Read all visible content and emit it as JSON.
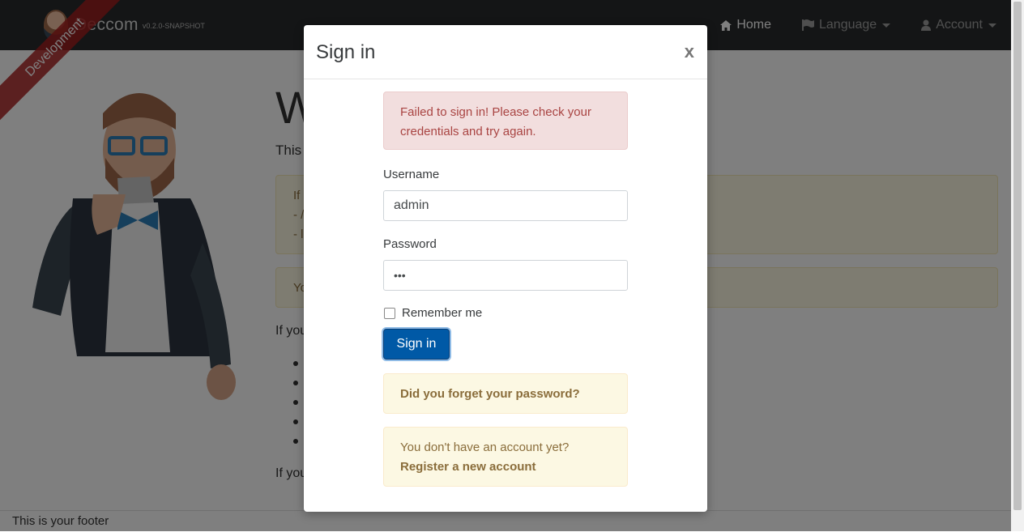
{
  "navbar": {
    "brand_name": "Deccom",
    "brand_version": "v0.2.0-SNAPSHOT",
    "ribbon": "Development",
    "items": [
      {
        "label": "Home",
        "icon": "home-icon",
        "active": true
      },
      {
        "label": "Language",
        "icon": "flag-icon",
        "dropdown": true
      },
      {
        "label": "Account",
        "icon": "user-icon",
        "dropdown": true
      }
    ]
  },
  "page": {
    "title_start": "W",
    "title_end": "!",
    "lead": "This",
    "warn1_lines": [
      "If",
      "- /",
      "- l"
    ],
    "warn2_line": "Yo",
    "text1": "If you",
    "text2": "If you"
  },
  "footer": {
    "text": "This is your footer"
  },
  "modal": {
    "title": "Sign in",
    "close": "x",
    "error": {
      "strong": "Failed to sign in!",
      "text": " Please check your credentials and try again."
    },
    "username_label": "Username",
    "username_value": "admin",
    "password_label": "Password",
    "password_value": "•••",
    "remember_label": "Remember me",
    "signin_button": "Sign in",
    "forgot_password": "Did you forget your password?",
    "no_account": "You don't have an account yet?",
    "register": "Register a new account"
  },
  "colors": {
    "navbar_bg": "#292b2c",
    "primary": "#0059a6",
    "danger_bg": "#f2dede",
    "danger_text": "#a94442",
    "warning_bg": "#fcf8e3",
    "warning_text": "#8a6d3b"
  }
}
